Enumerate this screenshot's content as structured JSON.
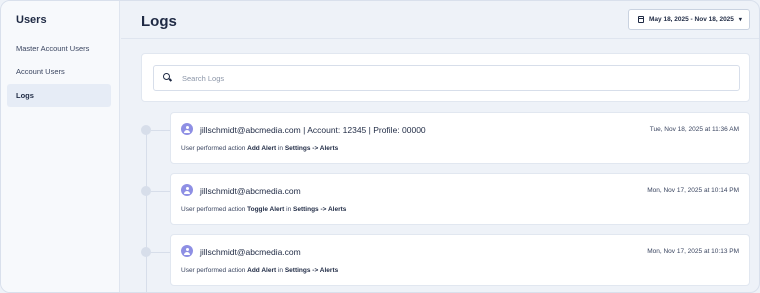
{
  "sidebar": {
    "title": "Users",
    "items": [
      {
        "label": "Master Account Users"
      },
      {
        "label": "Account Users"
      },
      {
        "label": "Logs"
      }
    ]
  },
  "header": {
    "title": "Logs",
    "date_range": "May 18, 2025 - Nov 18, 2025"
  },
  "search": {
    "placeholder": "Search Logs"
  },
  "logs": [
    {
      "user": "jillschmidt@abcmedia.com  |  Account: 12345  |  Profile: 00000",
      "timestamp": "Tue, Nov 18, 2025 at 11:36 AM",
      "prefix": "User performed action",
      "action": "Add Alert",
      "in": "in",
      "location": "Settings -> Alerts"
    },
    {
      "user": "jillschmidt@abcmedia.com",
      "timestamp": "Mon, Nov 17, 2025 at 10:14 PM",
      "prefix": "User performed action",
      "action": "Toggle Alert",
      "in": "in",
      "location": "Settings -> Alerts"
    },
    {
      "user": "jillschmidt@abcmedia.com",
      "timestamp": "Mon, Nov 17, 2025 at 10:13 PM",
      "prefix": "User performed action",
      "action": "Add Alert",
      "in": "in",
      "location": "Settings -> Alerts"
    }
  ]
}
